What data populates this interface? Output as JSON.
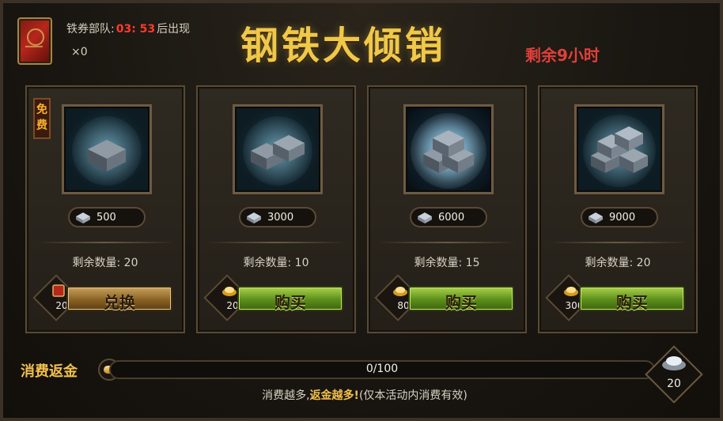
{
  "header": {
    "timer_prefix": "铁券部队:",
    "timer_value": "03: 53",
    "timer_suffix": "后出现",
    "ticket_count": "×0",
    "title": "钢铁大倾销",
    "remaining_time": "剩余9小时"
  },
  "cards": [
    {
      "free_tag": "免费",
      "amount": "500",
      "stock": "剩余数量: 20",
      "price": "20",
      "price_icon": "red-ticket-icon",
      "button_label": "兑换"
    },
    {
      "amount": "3000",
      "stock": "剩余数量: 10",
      "price": "20",
      "price_icon": "gold-ingot-icon",
      "button_label": "购买"
    },
    {
      "amount": "6000",
      "stock": "剩余数量: 15",
      "price": "80",
      "price_icon": "gold-ingot-icon",
      "button_label": "购买"
    },
    {
      "amount": "9000",
      "stock": "剩余数量: 20",
      "price": "300",
      "price_icon": "gold-ingot-icon",
      "button_label": "购买"
    }
  ],
  "rebate": {
    "label": "消费返金",
    "progress_text": "0/100",
    "progress_fraction": 0,
    "footnote_a": "消费越多,",
    "footnote_b": "返金越多!",
    "footnote_c": "(仅本活动内消费有效)",
    "reward_amount": "20",
    "reward_icon": "silver-ingot-icon"
  },
  "colors": {
    "title_gold": "#f0c84a",
    "timer_red": "#ff3a2a",
    "buy_green": "#7fb12b",
    "exchange_bronze": "#a8823e"
  }
}
